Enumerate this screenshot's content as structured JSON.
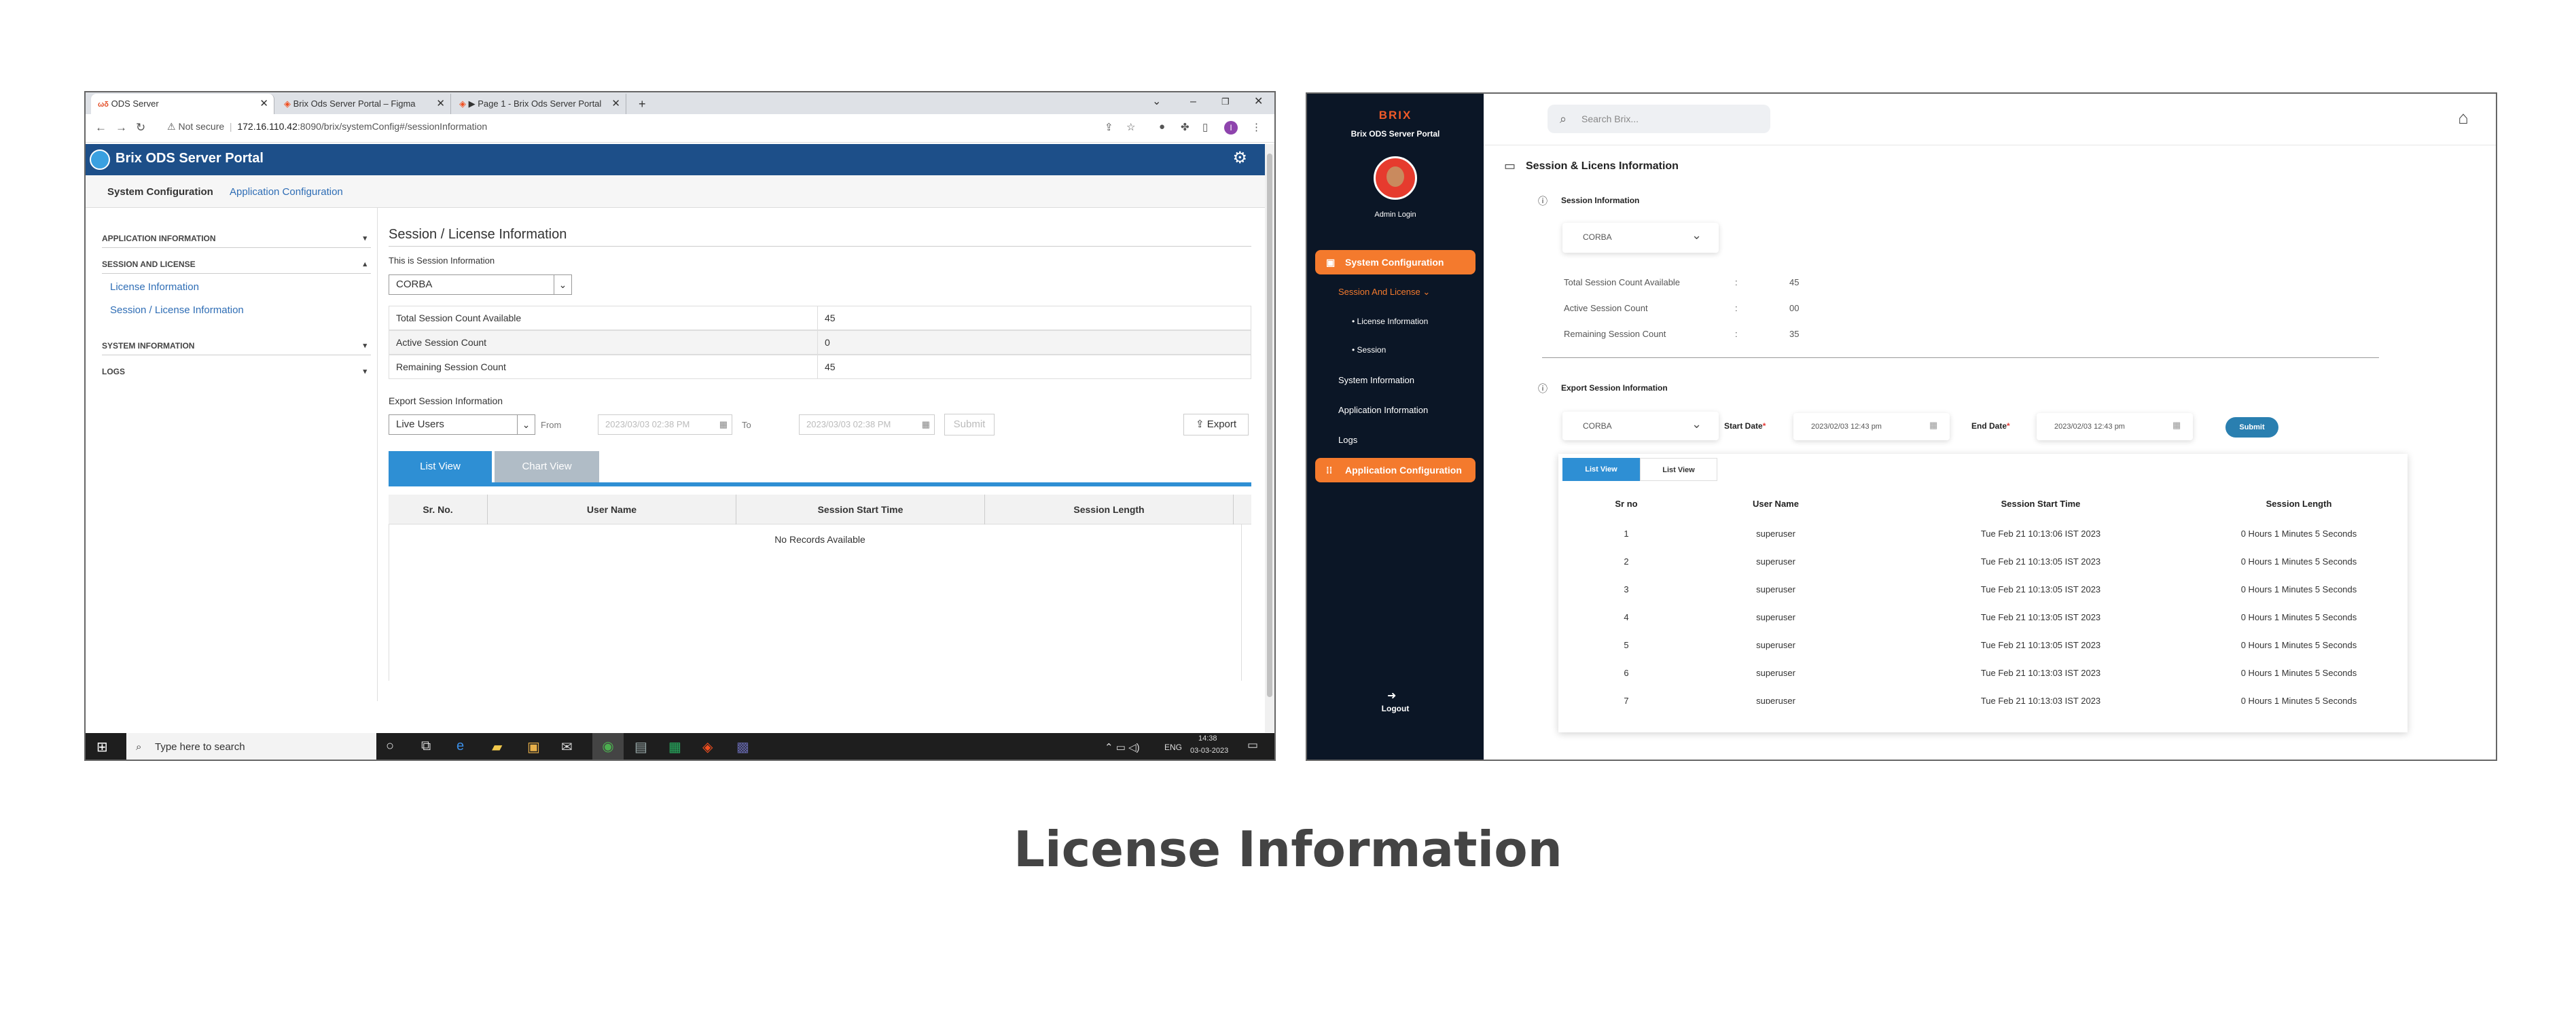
{
  "left": {
    "tabs": [
      "ODS Server",
      "Brix Ods Server Portal – Figma",
      "▶ Page 1 - Brix Ods Server Portal"
    ],
    "tab_new": "+",
    "window_controls": [
      "⌄",
      "–",
      "❐",
      "✕"
    ],
    "not_secure": "Not secure",
    "url_host": "172.16.110.42",
    "url_path": ":8090/brix/systemConfig#/sessionInformation",
    "profile_initial": "I",
    "portal_title": "Brix ODS Server Portal",
    "subnav": [
      "System Configuration",
      "Application Configuration"
    ],
    "sidebar": {
      "application_information": "APPLICATION INFORMATION",
      "session_and_license": "SESSION AND LICENSE",
      "license_information": "License Information",
      "session_license_information": "Session / License Information",
      "system_information": "SYSTEM INFORMATION",
      "logs": "LOGS"
    },
    "main": {
      "title": "Session / License Information",
      "subtitle": "This is Session Information",
      "protocol_select": "CORBA",
      "rows": [
        {
          "label": "Total Session Count Available",
          "value": "45"
        },
        {
          "label": "Active Session Count",
          "value": "0"
        },
        {
          "label": "Remaining Session Count",
          "value": "45"
        }
      ],
      "export_heading": "Export Session Information",
      "export_select": "Live Users",
      "from_label": "From",
      "from_value": "2023/03/03 02:38 PM",
      "to_label": "To",
      "to_value": "2023/03/03 02:38 PM",
      "submit": "Submit",
      "export": "Export",
      "list_view": "List View",
      "chart_view": "Chart View",
      "columns": [
        "Sr. No.",
        "User Name",
        "Session Start Time",
        "Session Length"
      ],
      "empty_message": "No Records Available"
    },
    "taskbar": {
      "search": "Type here to search",
      "lang": "ENG",
      "time": "14:38",
      "date": "03-03-2023"
    }
  },
  "right": {
    "brand": "BRIX",
    "portal": "Brix ODS Server Portal",
    "user": "Admin Login",
    "nav": {
      "system_configuration": "System Configuration",
      "session_and_license": "Session And License",
      "license_information": "License Information",
      "session": "Session",
      "system_information": "System Information",
      "application_information": "Application Information",
      "logs": "Logs",
      "application_configuration": "Application Configuration",
      "logout": "Logout"
    },
    "search_placeholder": "Search Brix...",
    "page_title": "Session & Licens Information",
    "session_info_heading": "Session Information",
    "protocol_select": "CORBA",
    "stats": [
      {
        "label": "Total Session Count Available",
        "sep": ":",
        "value": "45"
      },
      {
        "label": "Active Session Count",
        "sep": ":",
        "value": "00"
      },
      {
        "label": "Remaining Session Count",
        "sep": ":",
        "value": "35"
      }
    ],
    "export_heading": "Export Session Information",
    "export_select": "CORBA",
    "start_date_label": "Start Date",
    "start_date": "2023/02/03 12:43 pm",
    "end_date_label": "End Date",
    "end_date": "2023/02/03 12:43 pm",
    "required_mark": "*",
    "submit": "Submit",
    "list_view_active": "List View",
    "list_view": "List View",
    "columns": [
      "Sr no",
      "User Name",
      "Session Start Time",
      "Session Length"
    ],
    "rows": [
      {
        "no": "1",
        "user": "superuser",
        "start": "Tue Feb 21 10:13:06 IST 2023",
        "length": "0 Hours 1 Minutes 5 Seconds"
      },
      {
        "no": "2",
        "user": "superuser",
        "start": "Tue Feb 21 10:13:05 IST 2023",
        "length": "0 Hours 1 Minutes 5 Seconds"
      },
      {
        "no": "3",
        "user": "superuser",
        "start": "Tue Feb 21 10:13:05 IST 2023",
        "length": "0 Hours 1 Minutes 5 Seconds"
      },
      {
        "no": "4",
        "user": "superuser",
        "start": "Tue Feb 21 10:13:05 IST 2023",
        "length": "0 Hours 1 Minutes 5 Seconds"
      },
      {
        "no": "5",
        "user": "superuser",
        "start": "Tue Feb 21 10:13:05 IST 2023",
        "length": "0 Hours 1 Minutes 5 Seconds"
      },
      {
        "no": "6",
        "user": "superuser",
        "start": "Tue Feb 21 10:13:03 IST 2023",
        "length": "0 Hours 1 Minutes 5 Seconds"
      },
      {
        "no": "7",
        "user": "superuser",
        "start": "Tue Feb 21 10:13:03 IST 2023",
        "length": "0 Hours 1 Minutes 5 Seconds"
      }
    ]
  },
  "caption": "License Information",
  "colors": {
    "portal_blue": "#1d4f89",
    "brix_orange": "#f47a2d",
    "sidebar_dark": "#0b1626",
    "tab_blue": "#2e8fd4",
    "submit_teal": "#2a7fb0"
  }
}
